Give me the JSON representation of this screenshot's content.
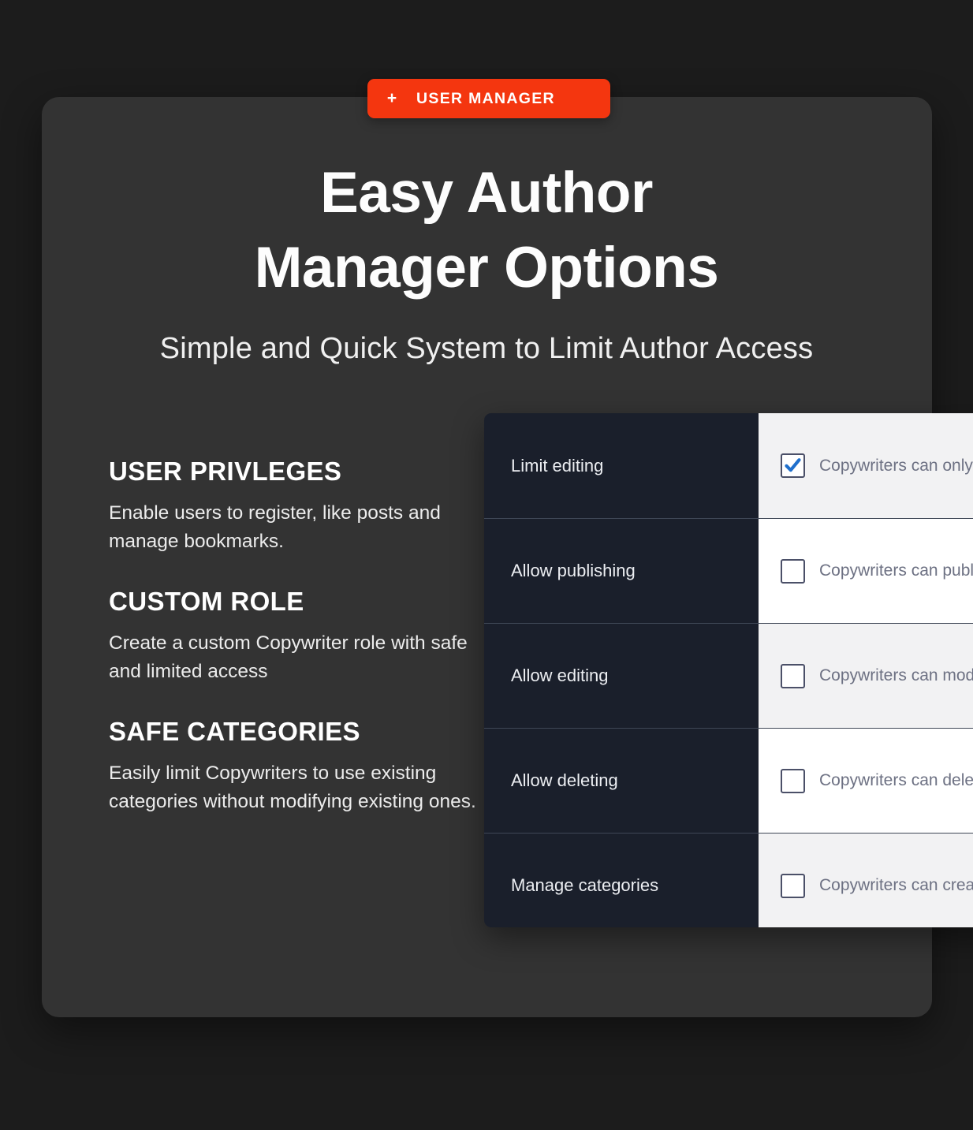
{
  "badge": {
    "plus_icon": "plus-icon",
    "plus_glyph": "+",
    "label": "USER MANAGER",
    "color": "#f4360f"
  },
  "headline": {
    "line1": "Easy Author",
    "line2": "Manager Options"
  },
  "subhead": {
    "text": "Simple and Quick System to Limit Author Access"
  },
  "features": [
    {
      "title": "USER PRIVLEGES",
      "desc": "Enable users to register, like posts and manage bookmarks."
    },
    {
      "title": "CUSTOM ROLE",
      "desc": "Create a custom Copywriter role with safe and limited access"
    },
    {
      "title": "SAFE CATEGORIES",
      "desc": "Easily limit Copywriters to use existing categories without modifying existing ones."
    }
  ],
  "settings_table": {
    "rows": [
      {
        "label": "Limit editing",
        "checked": true,
        "text": "Copywriters can only e"
      },
      {
        "label": "Allow publishing",
        "checked": false,
        "text": "Copywriters can publi"
      },
      {
        "label": "Allow editing",
        "checked": false,
        "text": "Copywriters can modi"
      },
      {
        "label": "Allow deleting",
        "checked": false,
        "text": "Copywriters can delet"
      },
      {
        "label": "Manage categories",
        "checked": false,
        "text": "Copywriters can creat"
      }
    ],
    "checkbox_checked_color": "#1f6fcc",
    "checkbox_border_color": "#4b5068",
    "label_bg": "#1a1f2b",
    "value_bg_alt": "#f2f2f3",
    "value_bg": "#ffffff"
  },
  "theme": {
    "page_bg": "#1c1c1c",
    "card_bg": "#333333",
    "text_light": "#ffffff"
  }
}
